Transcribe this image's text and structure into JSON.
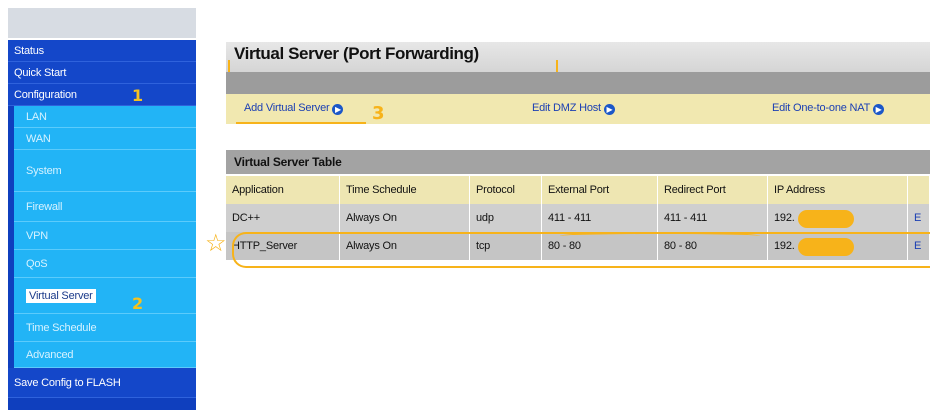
{
  "sidebar": {
    "items": [
      {
        "label": "Status",
        "level": "main"
      },
      {
        "label": "Quick Start",
        "level": "main"
      },
      {
        "label": "Configuration",
        "level": "main"
      },
      {
        "label": "LAN",
        "level": "sub"
      },
      {
        "label": "WAN",
        "level": "sub"
      },
      {
        "label": "System",
        "level": "sub"
      },
      {
        "label": "Firewall",
        "level": "sub"
      },
      {
        "label": "VPN",
        "level": "sub"
      },
      {
        "label": "QoS",
        "level": "sub"
      },
      {
        "label": "Virtual Server",
        "level": "sub",
        "active": true
      },
      {
        "label": "Time Schedule",
        "level": "sub"
      },
      {
        "label": "Advanced",
        "level": "sub"
      },
      {
        "label": "Save Config to FLASH",
        "level": "main"
      }
    ],
    "annotations": {
      "configuration": "1",
      "virtual_server": "2"
    }
  },
  "page": {
    "title": "Virtual Server (Port Forwarding)"
  },
  "links": {
    "add_virtual_server": "Add Virtual Server",
    "edit_dmz_host": "Edit DMZ Host",
    "edit_one_to_one_nat": "Edit One-to-one NAT",
    "annotation": "3"
  },
  "table": {
    "title": "Virtual Server Table",
    "columns": [
      "Application",
      "Time Schedule",
      "Protocol",
      "External Port",
      "Redirect Port",
      "IP Address",
      ""
    ],
    "rows": [
      {
        "application": "DC++",
        "time_schedule": "Always On",
        "protocol": "udp",
        "external_port": "411 - 411",
        "redirect_port": "411 - 411",
        "ip_address": "192.",
        "action": "E"
      },
      {
        "application": "HTTP_Server",
        "time_schedule": "Always On",
        "protocol": "tcp",
        "external_port": "80 - 80",
        "redirect_port": "80 - 80",
        "ip_address": "192.",
        "action": "E"
      }
    ]
  },
  "colors": {
    "sidebar_main": "#1447c9",
    "sidebar_sub": "#22b4f6",
    "annotation_orange": "#f7b31a",
    "link_bar": "#f1e8b0"
  }
}
